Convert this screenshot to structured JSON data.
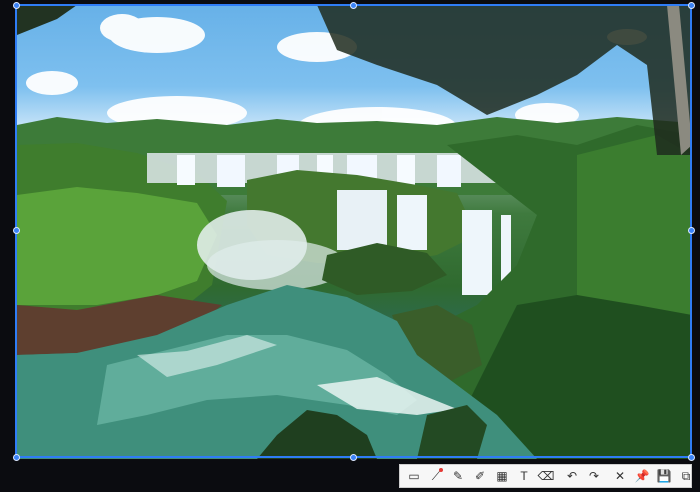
{
  "screenshot": {
    "scene_icon": "waterfall-landscape-photo",
    "tools": [
      {
        "name": "rectangle-icon",
        "glyph": "▭"
      },
      {
        "name": "line-chart-icon",
        "glyph": "⟋"
      },
      {
        "name": "pencil-icon",
        "glyph": "✎"
      },
      {
        "name": "marker-icon",
        "glyph": "✐"
      },
      {
        "name": "mosaic-icon",
        "glyph": "▦"
      },
      {
        "name": "text-icon",
        "glyph": "T"
      },
      {
        "name": "eraser-icon",
        "glyph": "⌫"
      },
      {
        "name": "undo-icon",
        "glyph": "↶"
      },
      {
        "name": "redo-icon",
        "glyph": "↷"
      },
      {
        "name": "close-icon",
        "glyph": "✕"
      },
      {
        "name": "pin-icon",
        "glyph": "📌"
      },
      {
        "name": "save-icon",
        "glyph": "💾"
      },
      {
        "name": "copy-icon",
        "glyph": "⧉"
      }
    ],
    "colors": {
      "selection": "#2f7df6",
      "badge": "#e53935"
    }
  }
}
